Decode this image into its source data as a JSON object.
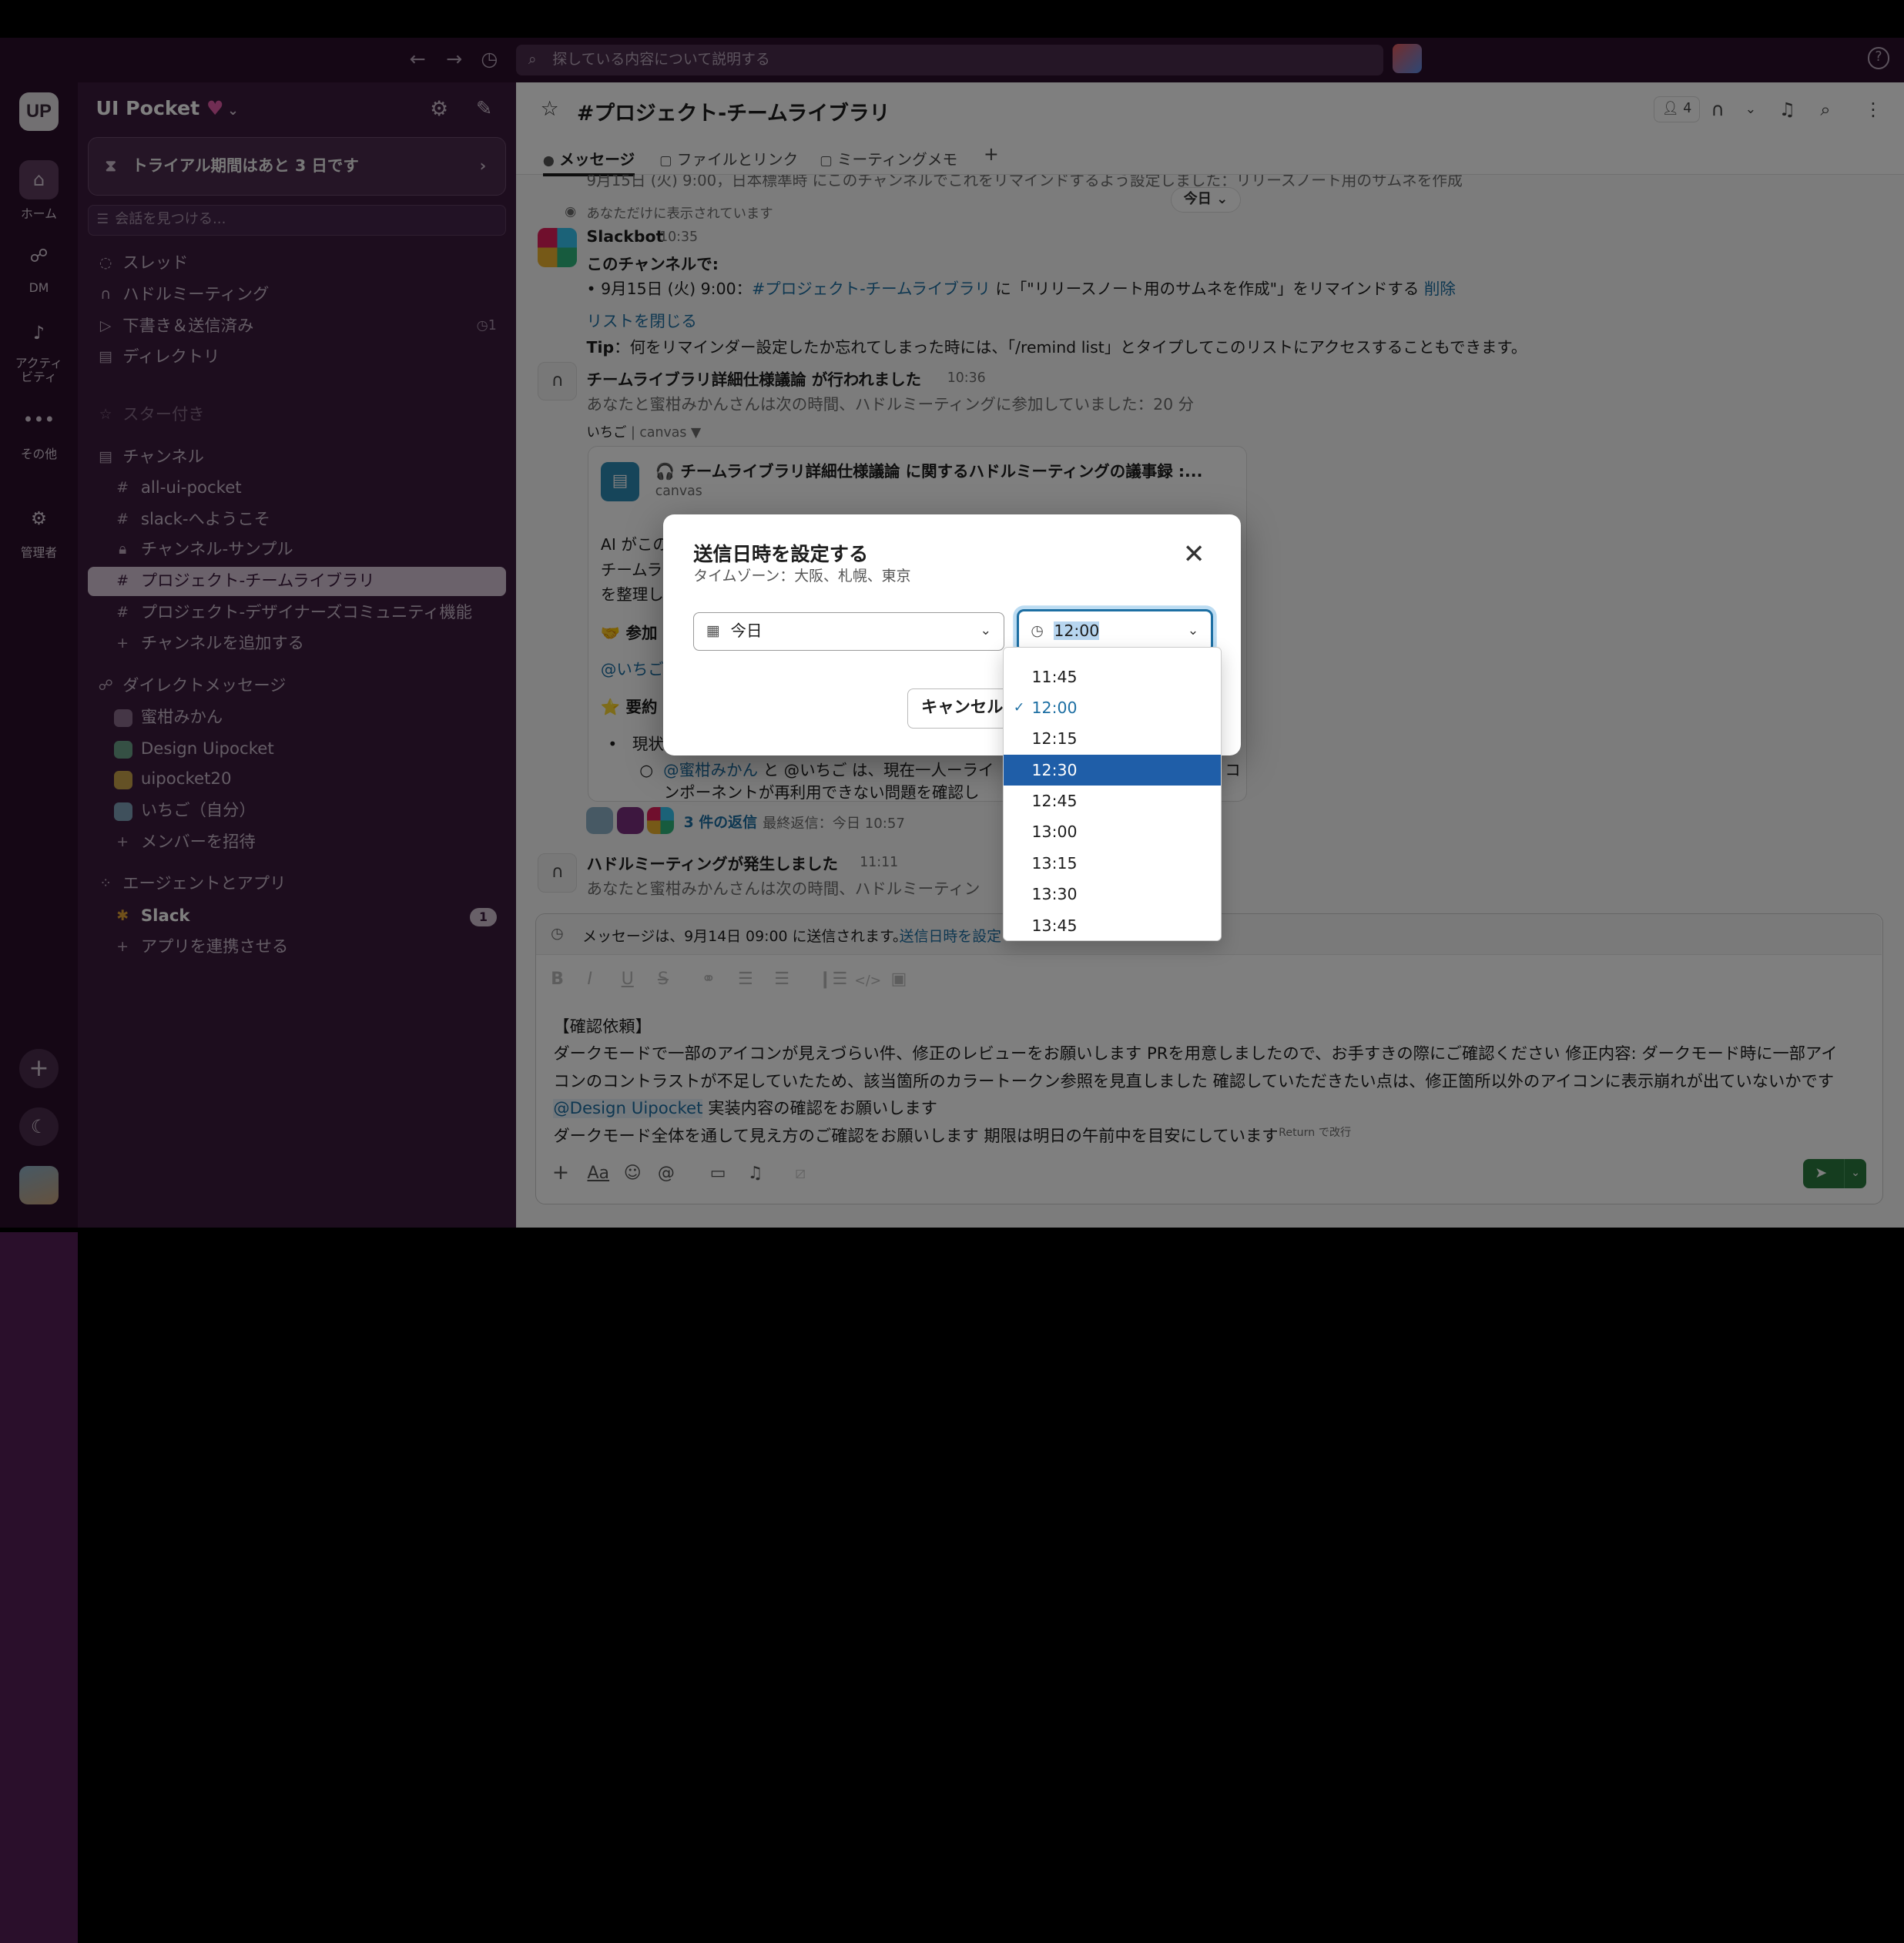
{
  "topbar": {
    "search_placeholder": "探している内容について説明する"
  },
  "rail": {
    "logo": "UP",
    "home": "ホーム",
    "dm": "DM",
    "activity": "アクティ\nビティ",
    "more": "その他",
    "admin": "管理者"
  },
  "sidebar": {
    "workspace": "UI Pocket",
    "trial": "トライアル期間はあと 3 日です",
    "find_placeholder": "会話を見つける...",
    "nav": [
      {
        "label": "スレッド"
      },
      {
        "label": "ハドルミーティング"
      },
      {
        "label": "下書き＆送信済み",
        "count": "1"
      },
      {
        "label": "ディレクトリ"
      }
    ],
    "starred": "スター付き",
    "channels_header": "チャンネル",
    "channels": [
      "all-ui-pocket",
      "slack-へようこそ",
      "チャンネル-サンプル",
      "プロジェクト-チームライブラリ",
      "プロジェクト-デザイナーズコミュニティ機能"
    ],
    "add_channel": "チャンネルを追加する",
    "dm_header": "ダイレクトメッセージ",
    "dms": [
      "蜜柑みかん",
      "Design Uipocket",
      "uipocket20",
      "いちご（自分）"
    ],
    "invite": "メンバーを招待",
    "apps_header": "エージェントとアプリ",
    "apps": [
      {
        "label": "Slack",
        "badge": "1"
      }
    ],
    "connect_app": "アプリを連携させる"
  },
  "channel": {
    "title": "#プロジェクト-チームライブラリ",
    "members": "4",
    "tabs": [
      "メッセージ",
      "ファイルとリンク",
      "ミーティングメモ"
    ],
    "today": "今日"
  },
  "messages": {
    "cut_line": "9月15日 (火) 9:00，日本標準時 にこのチャンネルでこれをリマインドするよう設定しました：リリースノート用のサムネを作成",
    "only_you": "あなただけに表示されています",
    "slackbot_name": "Slackbot",
    "slackbot_time": "10:35",
    "slackbot_line1": "このチャンネルで:",
    "slackbot_item_pre": "• 9月15日 (火) 9:00：",
    "slackbot_item_channel": "#プロジェクト-チームライブラリ",
    "slackbot_item_mid": " に「\"リリースノート用のサムネを作成\"」をリマインドする ",
    "slackbot_item_delete": "削除",
    "close_list": "リストを閉じる",
    "tip_label": "Tip",
    "tip_text": "：何をリマインダー設定したか忘れてしまった時には、「/remind list」とタイプしてこのリストにアクセスすることもできます。",
    "huddle1_title": "チームライブラリ詳細仕様議論 が行われました",
    "huddle1_time": "10:36",
    "huddle1_sub": "あなたと蜜柑みかんさんは次の時間、ハドルミーティングに参加していました：20 分",
    "huddle1_meta_a": "いちご",
    "huddle1_meta_b": "| canvas ▼",
    "canvas_title": "🎧 チームライブラリ詳細仕様議論 に関するハドルミーティングの議事録 :...",
    "canvas_type": "canvas",
    "canvas_l1": "AI がこの",
    "canvas_l2": "チームラ",
    "canvas_l3": "を整理し",
    "canvas_sec1": "🤝 参加",
    "canvas_m1": "@いちご",
    "canvas_sec2": "⭐ 要約",
    "canvas_b1": "現状",
    "canvas_sub_mention1": "@蜜柑みかん",
    "canvas_sub_rest": " と @いちご は、現在一人ーライ",
    "canvas_sub_end": "コ",
    "canvas_sub_l2": "ンポーネントが再利用できない問題を確認し",
    "replies": "3 件の返信",
    "last_reply": "最終返信：今日 10:57",
    "huddle2_title": "ハドルミーティングが発生しました",
    "huddle2_time": "11:11",
    "huddle2_sub": "あなたと蜜柑みかんさんは次の時間、ハドルミーティン"
  },
  "composer": {
    "sched_text": "メッセージは、9月14日 09:00 に送信されます。",
    "sched_link": "送信日時を設定",
    "line1": "【確認依頼】",
    "line2": "ダークモードで一部のアイコンが見えづらい件、修正のレビューをお願いします PRを用意しましたので、お手すきの際にご確認ください 修正内容: ダークモード時に一部アイ",
    "line3": "コンのコントラストが不足していたため、該当箇所のカラートークン参照を見直しました 確認していただきたい点は、修正箇所以外のアイコンに表示崩れが出ていないかです",
    "mention": "@Design Uipocket",
    "line4_rest": " 実装内容の確認をお願いします",
    "line5": "ダークモード全体を通して見え方のご確認をお願いします 期限は明日の午前中を目安にしています",
    "return_hint": "Return で改行"
  },
  "modal": {
    "title": "送信日時を設定する",
    "subtitle": "タイムゾーン：大阪、札幌、東京",
    "date_value": "今日",
    "time_value": "12:00",
    "cancel": "キャンセル",
    "options": [
      "11:45",
      "12:00",
      "12:15",
      "12:30",
      "12:45",
      "13:00",
      "13:15",
      "13:30",
      "13:45"
    ],
    "selected": "12:00",
    "highlighted": "12:30"
  },
  "colors": {
    "sidebar": "#3b1a3d",
    "rail": "#2a0f2b",
    "accent": "#1d6fa3",
    "highlight": "#1f5ea8",
    "send": "#2a7a3e"
  }
}
